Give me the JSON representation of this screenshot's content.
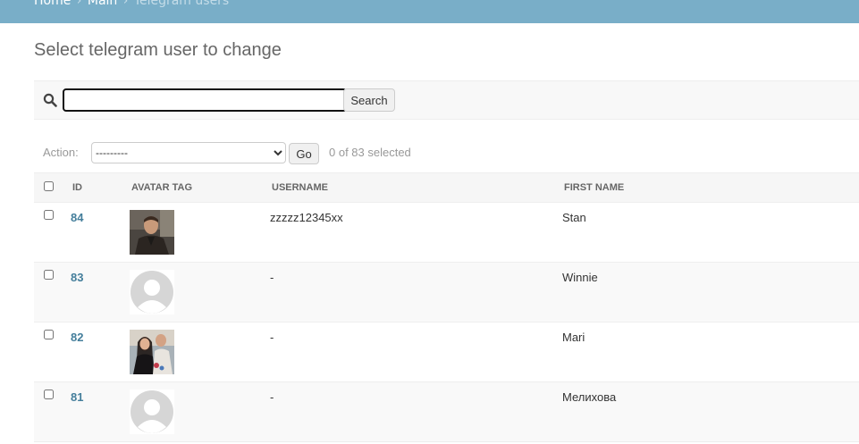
{
  "breadcrumbs": {
    "home": "Home",
    "separator": "›",
    "app": "Main",
    "current": "Telegram users"
  },
  "page_title": "Select telegram user to change",
  "search": {
    "value": "",
    "placeholder": "",
    "button_label": "Search"
  },
  "actions": {
    "label": "Action:",
    "selected_option": "---------",
    "go_label": "Go",
    "selection_count": "0 of 83 selected"
  },
  "table": {
    "columns": [
      "ID",
      "AVATAR TAG",
      "USERNAME",
      "FIRST NAME"
    ],
    "rows": [
      {
        "id": "84",
        "avatar": "photo-man-leather-jacket",
        "username": "zzzzz12345xx",
        "first_name": "Stan"
      },
      {
        "id": "83",
        "avatar": "default-avatar-placeholder",
        "username": "-",
        "first_name": "Winnie"
      },
      {
        "id": "82",
        "avatar": "photo-couple-group",
        "username": "-",
        "first_name": "Mari"
      },
      {
        "id": "81",
        "avatar": "default-avatar-placeholder",
        "username": "-",
        "first_name": "Мелихова"
      }
    ]
  },
  "colors": {
    "breadcrumb_bar": "#79aec8",
    "link": "#447e9b",
    "placeholder_avatar": "#d6d6d6"
  }
}
